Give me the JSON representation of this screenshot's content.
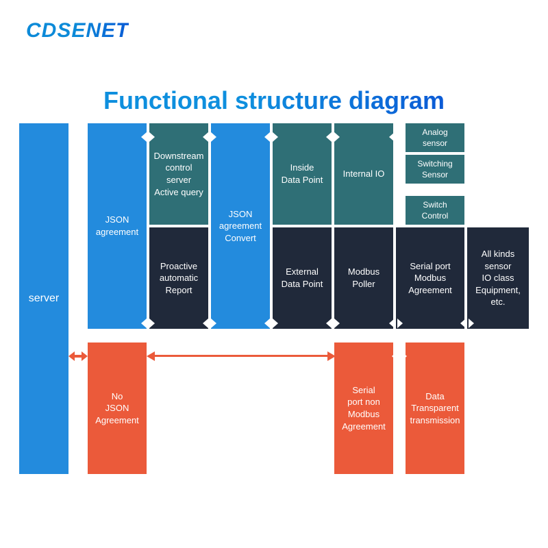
{
  "brand": "CDSENET",
  "title": "Functional structure diagram",
  "boxes": {
    "server": "server",
    "json_agreement": "JSON\nagreement",
    "downstream": "Downstream\ncontrol\nserver\nActive query",
    "proactive": "Proactive\nautomatic\nReport",
    "json_convert": "JSON\nagreement\nConvert",
    "inside_dp": "Inside\nData Point",
    "external_dp": "External\nData Point",
    "internal_io": "Internal IO",
    "modbus_poller": "Modbus\nPoller",
    "analog_sensor": "Analog\nsensor",
    "switching_sensor": "Switching\nSensor",
    "switch_control": "Switch\nControl",
    "serial_modbus": "Serial port\nModbus\nAgreement",
    "all_kinds": "All kinds\nsensor\nIO class\nEquipment,\netc.",
    "no_json": "No\nJSON\nAgreement",
    "serial_non_modbus": "Serial\nport non\nModbus\nAgreement",
    "data_transparent": "Data\nTransparent\ntransmission"
  }
}
